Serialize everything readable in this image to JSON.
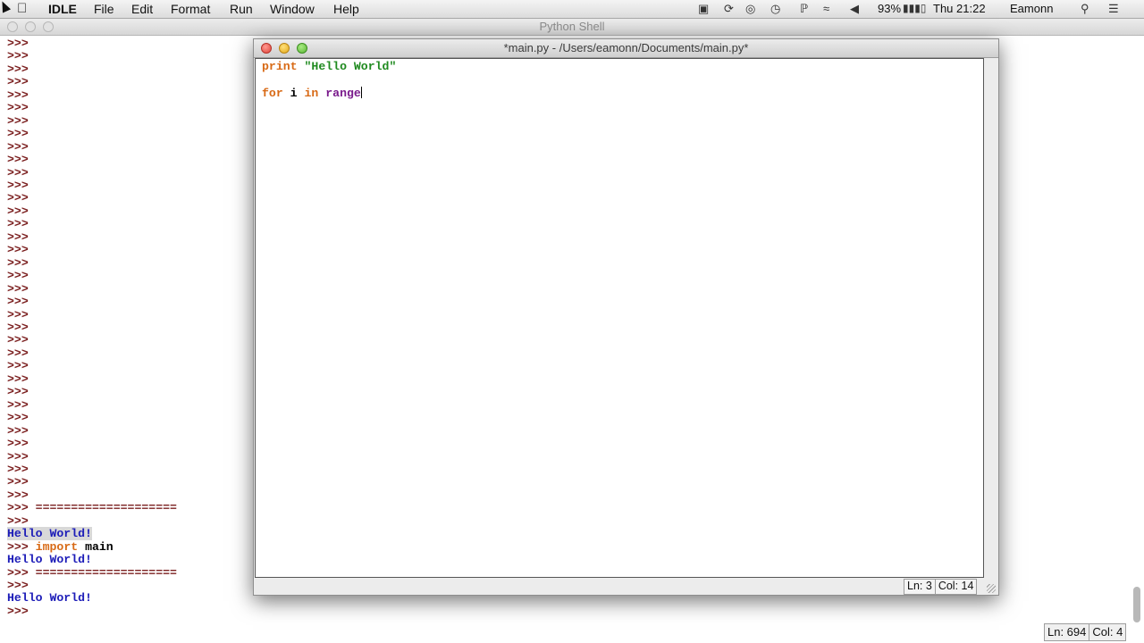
{
  "menubar": {
    "app_name": "IDLE",
    "menus": [
      "File",
      "Edit",
      "Format",
      "Run",
      "Window",
      "Help"
    ],
    "battery": "93%",
    "clock": "Thu 21:22",
    "user": "Eamonn"
  },
  "shell": {
    "title": "Python Shell",
    "prompt": ">>>",
    "separator": "====================",
    "output_text": "Hello World!",
    "import_keyword": "import",
    "import_module": " main",
    "status": {
      "ln": "Ln: 694",
      "col": "Col: 4"
    }
  },
  "editor": {
    "title": "*main.py - /Users/eamonn/Documents/main.py*",
    "code": {
      "line1": {
        "keyword": "print",
        "string": "\"Hello World\""
      },
      "line3": {
        "kw_for": "for",
        "var": " i ",
        "kw_in": "in",
        "builtin": "range"
      }
    },
    "status": {
      "ln": "Ln: 3",
      "col": "Col: 14"
    }
  }
}
